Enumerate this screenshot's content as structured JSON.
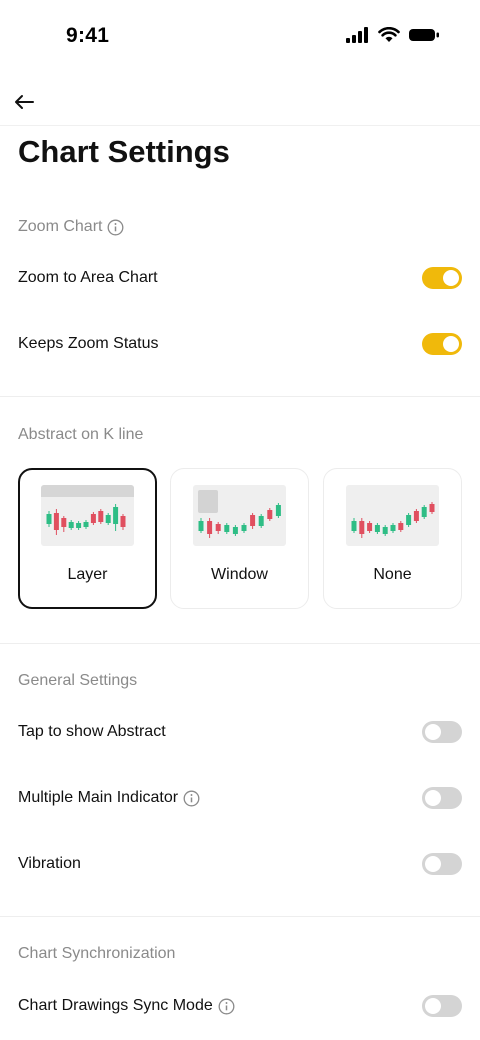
{
  "status_bar": {
    "time": "9:41"
  },
  "page": {
    "title": "Chart Settings"
  },
  "zoom_section": {
    "header": "Zoom Chart",
    "items": [
      {
        "label": "Zoom to Area Chart",
        "enabled": true
      },
      {
        "label": "Keeps Zoom Status",
        "enabled": true
      }
    ]
  },
  "abstract_section": {
    "header": "Abstract on K line",
    "options": [
      {
        "label": "Layer",
        "selected": true
      },
      {
        "label": "Window",
        "selected": false
      },
      {
        "label": "None",
        "selected": false
      }
    ]
  },
  "general_section": {
    "header": "General Settings",
    "items": [
      {
        "label": "Tap to show Abstract",
        "enabled": false
      },
      {
        "label": "Multiple Main Indicator",
        "enabled": false,
        "info_icon": true
      },
      {
        "label": "Vibration",
        "enabled": false
      }
    ]
  },
  "sync_section": {
    "header": "Chart Synchronization",
    "items": [
      {
        "label": "Chart Drawings Sync Mode",
        "enabled": false,
        "info_icon": true
      }
    ]
  },
  "colors": {
    "toggle_on": "#f0b90b",
    "toggle_off": "#d4d4d4",
    "candle_up": "#2ebd85",
    "candle_down": "#e04f5f",
    "section_header": "#8a8a8a"
  }
}
